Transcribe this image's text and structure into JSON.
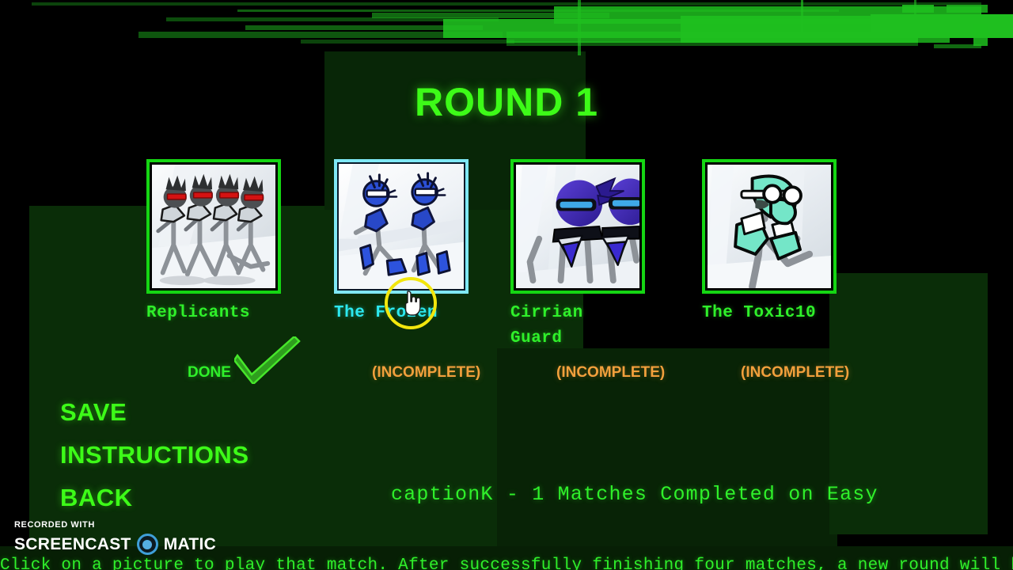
{
  "screen": {
    "title": "ROUND 1",
    "accent_green": "#3dfb18",
    "label_green": "#2ff02a",
    "incomplete_orange": "#f2a03c",
    "selected_cyan": "#2ce8ef",
    "highlight_yellow": "#f2e60d",
    "background": "#000000",
    "panel_green": "#0a2d08"
  },
  "matches": [
    {
      "name": "Replicants",
      "status": "DONE",
      "status_kind": "done",
      "selected": false,
      "icon": "replicants-thumbnail"
    },
    {
      "name": "The Frozen",
      "status": "(INCOMPLETE)",
      "status_kind": "incomplete",
      "selected": true,
      "icon": "the-frozen-thumbnail"
    },
    {
      "name": "Cirrian\nGuard",
      "status": "(INCOMPLETE)",
      "status_kind": "incomplete",
      "selected": false,
      "icon": "cirrian-guard-thumbnail"
    },
    {
      "name": "The Toxic10",
      "status": "(INCOMPLETE)",
      "status_kind": "incomplete",
      "selected": false,
      "icon": "the-toxic10-thumbnail"
    }
  ],
  "menu": {
    "save": "SAVE",
    "instructions": "INSTRUCTIONS",
    "back": "BACK"
  },
  "progress": {
    "text": "captionK - 1 Matches Completed on Easy",
    "player": "captionK",
    "matches_completed": 1,
    "difficulty": "Easy"
  },
  "hint": {
    "text": "Click on a picture to play that match. After successfully finishing four matches, a new round will be unlocked."
  },
  "watermark": {
    "line1": "RECORDED WITH",
    "word1": "SCREENCAST",
    "word2": "MATIC",
    "dot_color": "#55aee2"
  }
}
